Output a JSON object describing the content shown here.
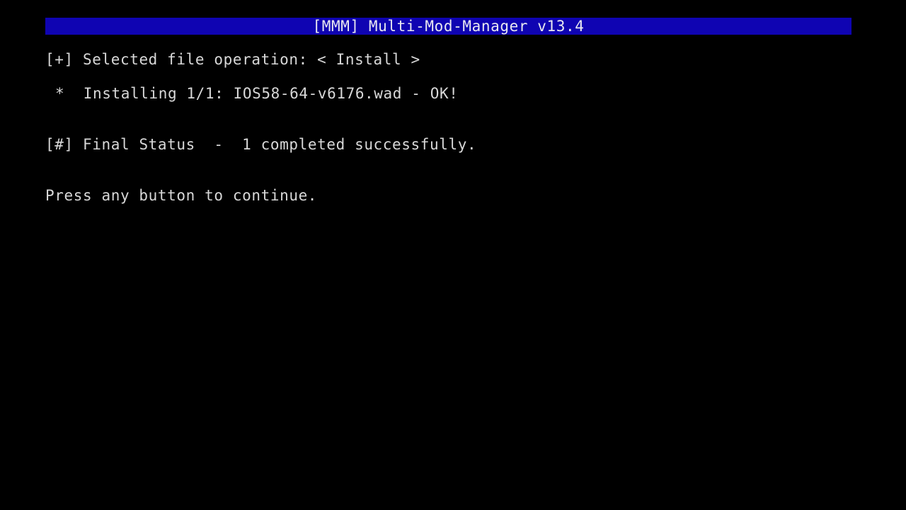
{
  "window": {
    "title": "[MMM] Multi-Mod-Manager v13.4"
  },
  "operation": {
    "prefix": "[+]",
    "label": "Selected file operation:",
    "selector_left": "<",
    "value": "Install",
    "selector_right": ">"
  },
  "install_line": {
    "bullet": "*",
    "progress_label": "Installing 1/1:",
    "filename": "IOS58-64-v6176.wad",
    "separator": "-",
    "result": "OK!"
  },
  "final_status": {
    "prefix": "[#]",
    "label": "Final Status",
    "separator": "-",
    "message": "1 completed successfully."
  },
  "prompt": {
    "text": "Press any button to continue."
  },
  "colors": {
    "background": "#000000",
    "title_bar": "#0f04b2",
    "text": "#d8d8d8"
  }
}
